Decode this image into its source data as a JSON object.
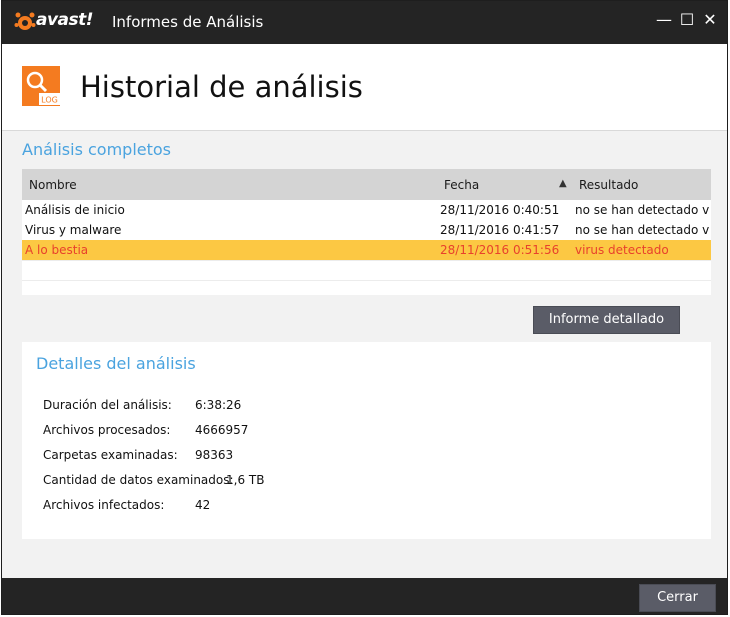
{
  "titlebar": {
    "brand": "avast!",
    "title": "Informes de Análisis",
    "minimize_glyph": "—",
    "maximize_glyph": "☐",
    "close_glyph": "✕"
  },
  "header": {
    "icon_label": "LOG",
    "title": "Historial de análisis"
  },
  "completed": {
    "title": "Análisis completos",
    "columns": [
      "Nombre",
      "Fecha",
      "Resultado"
    ],
    "rows": [
      {
        "name": "Análisis de inicio",
        "date": "28/11/2016 0:40:51",
        "result": "no se han detectado vi..."
      },
      {
        "name": "Virus y malware",
        "date": "28/11/2016 0:41:57",
        "result": "no se han detectado vi..."
      },
      {
        "name": "A lo bestia",
        "date": "28/11/2016 0:51:56",
        "result": "virus detectado"
      }
    ]
  },
  "detailed_report_button": "Informe detallado",
  "details": {
    "title": "Detalles del análisis",
    "items": [
      {
        "label": "Duración del análisis:",
        "value": "6:38:26"
      },
      {
        "label": "Archivos procesados:",
        "value": "4666957"
      },
      {
        "label": "Carpetas examinadas:",
        "value": "98363"
      },
      {
        "label": "Cantidad de datos examinados:",
        "value": "1,6 TB"
      },
      {
        "label": "Archivos infectados:",
        "value": "42"
      }
    ]
  },
  "close_button": "Cerrar",
  "colors": {
    "accent": "#4aa3df",
    "brand_orange": "#f47b20",
    "selected_row": "#fcc843",
    "alert_text": "#e8412c"
  }
}
